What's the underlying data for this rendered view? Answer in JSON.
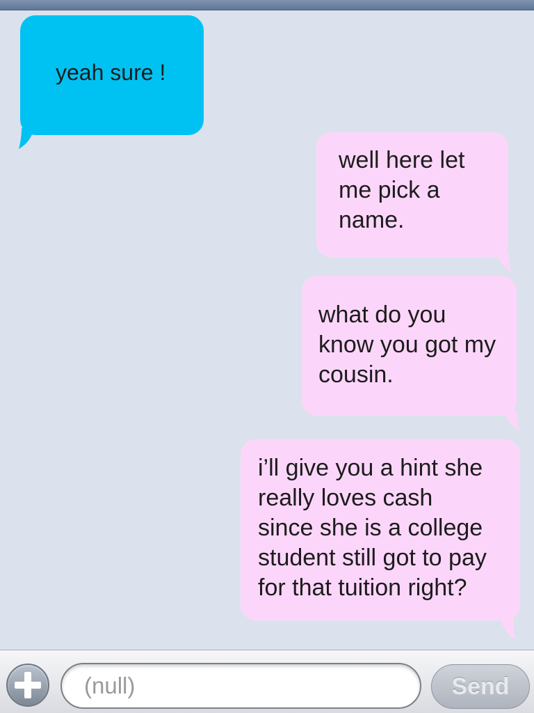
{
  "colors": {
    "background": "#dbe2ed",
    "incoming_bubble": "#00c2f2",
    "outgoing_bubble": "#fcd6fa",
    "text": "#1c1c1c"
  },
  "messages": [
    {
      "direction": "incoming",
      "text": "yeah sure !"
    },
    {
      "direction": "outgoing",
      "text": "well here let\nme pick a\nname."
    },
    {
      "direction": "outgoing",
      "text": "what do you\nknow you got my\ncousin."
    },
    {
      "direction": "outgoing",
      "text": "i’ll give you a hint she\nreally loves cash\nsince she is a college\nstudent still got to pay\nfor that tuition right?"
    }
  ],
  "input_bar": {
    "attach_icon": "plus-icon",
    "placeholder": "(null)",
    "send_label": "Send"
  }
}
